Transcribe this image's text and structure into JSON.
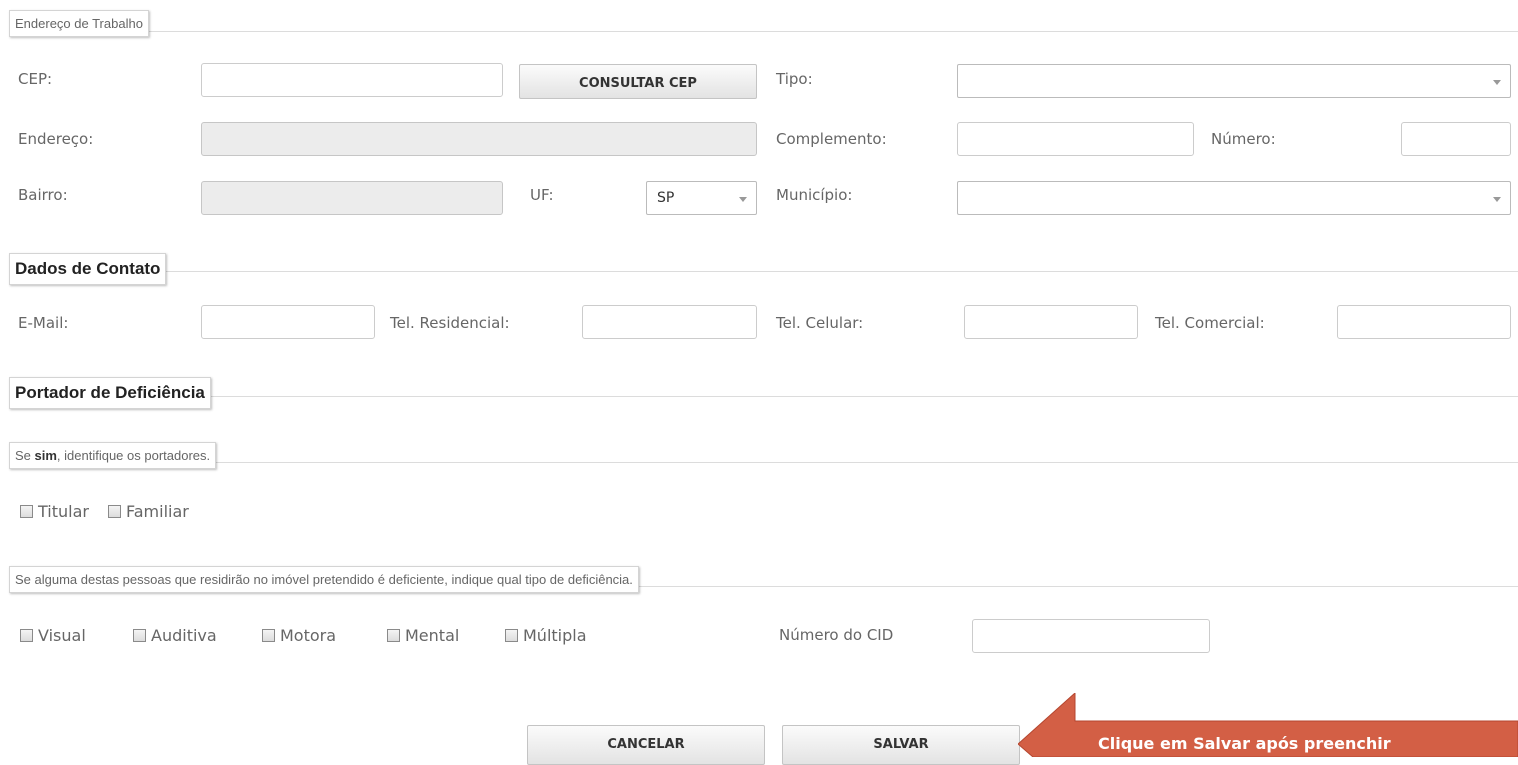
{
  "work_address": {
    "legend": "Endereço de Trabalho",
    "cep_label": "CEP:",
    "cep_value": "",
    "consultar_cep_label": "CONSULTAR CEP",
    "tipo_label": "Tipo:",
    "tipo_value": "",
    "endereco_label": "Endereço:",
    "endereco_value": "",
    "complemento_label": "Complemento:",
    "complemento_value": "",
    "numero_label": "Número:",
    "numero_value": "",
    "bairro_label": "Bairro:",
    "bairro_value": "",
    "uf_label": "UF:",
    "uf_value": "SP",
    "municipio_label": "Município:",
    "municipio_value": ""
  },
  "contact": {
    "legend": "Dados de Contato",
    "email_label": "E-Mail:",
    "tel_residencial_label": "Tel. Residencial:",
    "tel_celular_label": "Tel. Celular:",
    "tel_comercial_label": "Tel. Comercial:"
  },
  "disability": {
    "legend": "Portador de Deficiência",
    "hint_prefix": "Se ",
    "hint_bold": "sim",
    "hint_suffix": ", identifique os portadores.",
    "holders": [
      {
        "label": "Titular",
        "checked": false
      },
      {
        "label": "Familiar",
        "checked": false
      }
    ],
    "type_hint": "Se alguma destas pessoas que residirão no imóvel pretendido é deficiente, indique qual tipo de deficiência.",
    "types": [
      {
        "label": "Visual",
        "checked": false
      },
      {
        "label": "Auditiva",
        "checked": false
      },
      {
        "label": "Motora",
        "checked": false
      },
      {
        "label": "Mental",
        "checked": false
      },
      {
        "label": "Múltipla",
        "checked": false
      }
    ],
    "cid_label": "Número do CID",
    "cid_value": ""
  },
  "actions": {
    "cancel_label": "CANCELAR",
    "save_label": "SALVAR"
  },
  "callout": {
    "text": "Clique em Salvar após preenchir",
    "color": "#d35f45"
  }
}
